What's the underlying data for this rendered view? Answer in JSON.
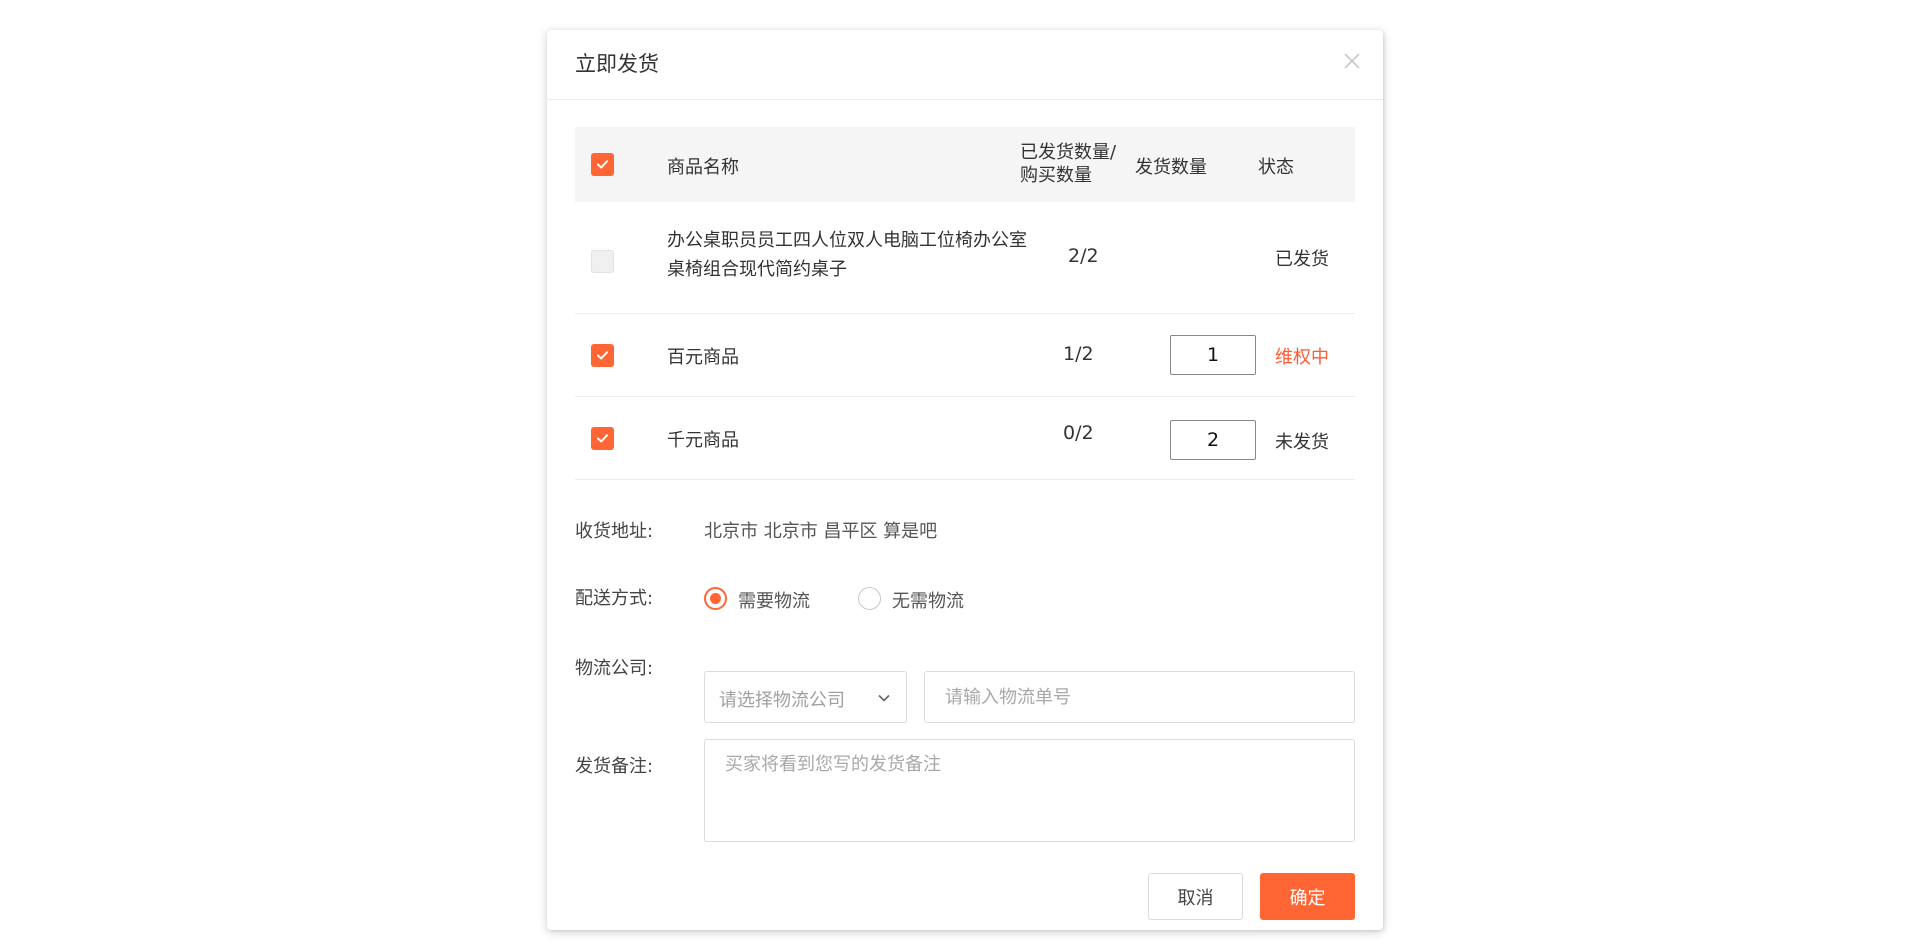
{
  "dialog": {
    "title": "立即发货"
  },
  "table": {
    "headers": {
      "name": "商品名称",
      "sent_buy_line1": "已发货数量/",
      "sent_buy_line2": "购买数量",
      "ship_qty": "发货数量",
      "status": "状态"
    },
    "rows": [
      {
        "name_line1": "办公桌职员员工四人位双人电脑工位椅办公室",
        "name_line2": "桌椅组合现代简约桌子",
        "sent": "2/2",
        "ship_qty": "",
        "status": "已发货",
        "checked": false,
        "disabled": true
      },
      {
        "name_line1": "百元商品",
        "sent": "1/2",
        "ship_qty": "1",
        "status": "维权中",
        "checked": true,
        "disabled": false
      },
      {
        "name_line1": "千元商品",
        "sent": "0/2",
        "ship_qty": "2",
        "status": "未发货",
        "checked": true,
        "disabled": false
      }
    ]
  },
  "form": {
    "address_label": "收货地址:",
    "address_value": "北京市 北京市 昌平区 算是吧",
    "delivery_label": "配送方式:",
    "delivery_options": [
      "需要物流",
      "无需物流"
    ],
    "delivery_selected": "需要物流",
    "logistics_label": "物流公司:",
    "logistics_select_placeholder": "请选择物流公司",
    "tracking_placeholder": "请输入物流单号",
    "remark_label": "发货备注:",
    "remark_placeholder": "买家将看到您写的发货备注"
  },
  "buttons": {
    "cancel": "取消",
    "confirm": "确定"
  },
  "colors": {
    "accent": "#ff6633",
    "status_warning": "#ff5a36"
  }
}
